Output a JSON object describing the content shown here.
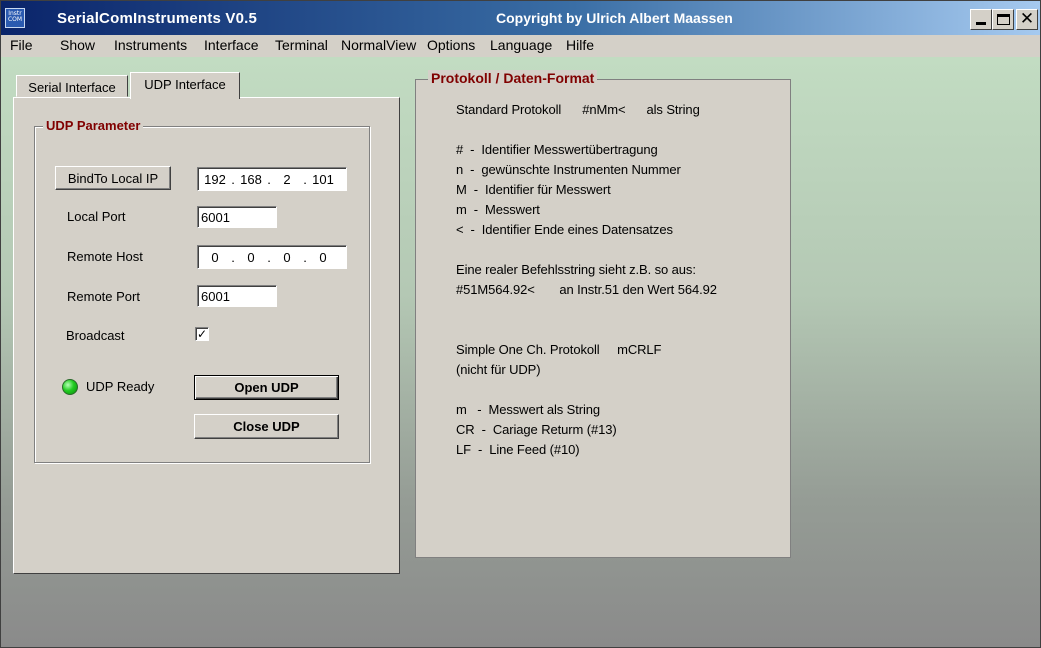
{
  "window": {
    "app_icon_text": "Instr COM",
    "title": "SerialComInstruments  V0.5",
    "copyright": "Copyright by Ulrich Albert Maassen",
    "close_glyph": "✕"
  },
  "menu": [
    "File",
    "Show",
    "Instruments",
    "Interface",
    "Terminal",
    "NormalView",
    "Options",
    "Language",
    "Hilfe"
  ],
  "tabs": {
    "serial": "Serial Interface",
    "udp": "UDP Interface",
    "active": "UDP Interface"
  },
  "udp": {
    "group_title": "UDP Parameter",
    "bind_button": "BindTo Local IP",
    "local_ip": [
      "192",
      "168",
      "2",
      "101"
    ],
    "local_port_label": "Local Port",
    "local_port": "6001",
    "remote_host_label": "Remote Host",
    "remote_host": [
      "0",
      "0",
      "0",
      "0"
    ],
    "remote_port_label": "Remote Port",
    "remote_port": "6001",
    "broadcast_label": "Broadcast",
    "broadcast_checked": true,
    "broadcast_mark": "✓",
    "status_label": "UDP Ready",
    "status_color": "#22cc22",
    "open_button": "Open UDP",
    "close_button": "Close UDP"
  },
  "protocol": {
    "group_title": "Protokoll / Daten-Format",
    "lines": [
      "Standard Protokoll      #nMm<      als String",
      "",
      "#  -  Identifier Messwertübertragung",
      "n  -  gewünschte Instrumenten Nummer",
      "M  -  Identifier für Messwert",
      "m  -  Messwert",
      "<  -  Identifier Ende eines Datensatzes",
      "",
      "Eine realer Befehlsstring sieht z.B. so aus:",
      "#51M564.92<       an Instr.51 den Wert 564.92",
      "",
      "",
      "Simple One Ch. Protokoll     mCRLF",
      "(nicht für UDP)",
      "",
      "m   -  Messwert als String",
      "CR  -  Cariage Returm (#13)",
      "LF  -  Line Feed (#10)"
    ]
  },
  "colors": {
    "title_active": "#0a246a",
    "group_title": "#800000",
    "face": "#d4d0c8"
  }
}
